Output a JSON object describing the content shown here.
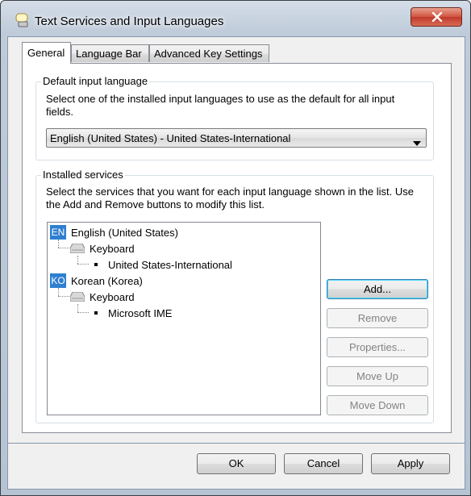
{
  "window": {
    "title": "Text Services and Input Languages"
  },
  "tabs": [
    {
      "label": "General",
      "active": true
    },
    {
      "label": "Language Bar",
      "active": false
    },
    {
      "label": "Advanced Key Settings",
      "active": false
    }
  ],
  "default_input": {
    "legend": "Default input language",
    "description": "Select one of the installed input languages to use as the default for all input fields.",
    "selected": "English (United States) - United States-International"
  },
  "installed_services": {
    "legend": "Installed services",
    "description": "Select the services that you want for each input language shown in the list. Use the Add and Remove buttons to modify this list.",
    "tree": [
      {
        "badge": "EN",
        "language": "English (United States)",
        "category": "Keyboard",
        "layout": "United States-International"
      },
      {
        "badge": "KO",
        "language": "Korean (Korea)",
        "category": "Keyboard",
        "layout": "Microsoft IME"
      }
    ],
    "buttons": {
      "add": "Add...",
      "remove": "Remove",
      "properties": "Properties...",
      "move_up": "Move Up",
      "move_down": "Move Down"
    }
  },
  "footer": {
    "ok": "OK",
    "cancel": "Cancel",
    "apply": "Apply"
  },
  "colors": {
    "accent": "#2e7fd1",
    "close_button": "#c0392b"
  },
  "icons": [
    "text-services-icon",
    "close-icon",
    "keyboard-icon",
    "dropdown-arrow-icon"
  ]
}
